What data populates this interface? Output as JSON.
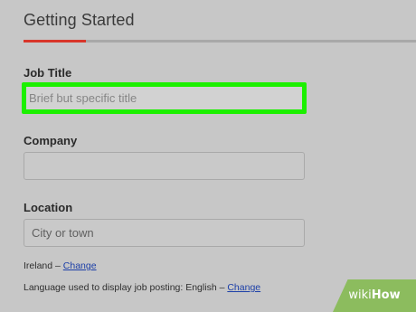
{
  "header": {
    "title": "Getting Started",
    "progress_fraction": 0.16
  },
  "form": {
    "job_title": {
      "label": "Job Title",
      "placeholder": "Brief but specific title",
      "value": ""
    },
    "company": {
      "label": "Company",
      "placeholder": "",
      "value": ""
    },
    "location": {
      "label": "Location",
      "placeholder": "City or town",
      "value": ""
    }
  },
  "country_line": {
    "text": "Ireland – ",
    "link": "Change"
  },
  "language_line": {
    "text": "Language used to display job posting: English – ",
    "link": "Change"
  },
  "watermark": {
    "prefix": "wiki",
    "suffix": "How"
  },
  "colors": {
    "highlight": "#1cf000",
    "progress": "#d8362a",
    "link": "#1c3fa8"
  }
}
